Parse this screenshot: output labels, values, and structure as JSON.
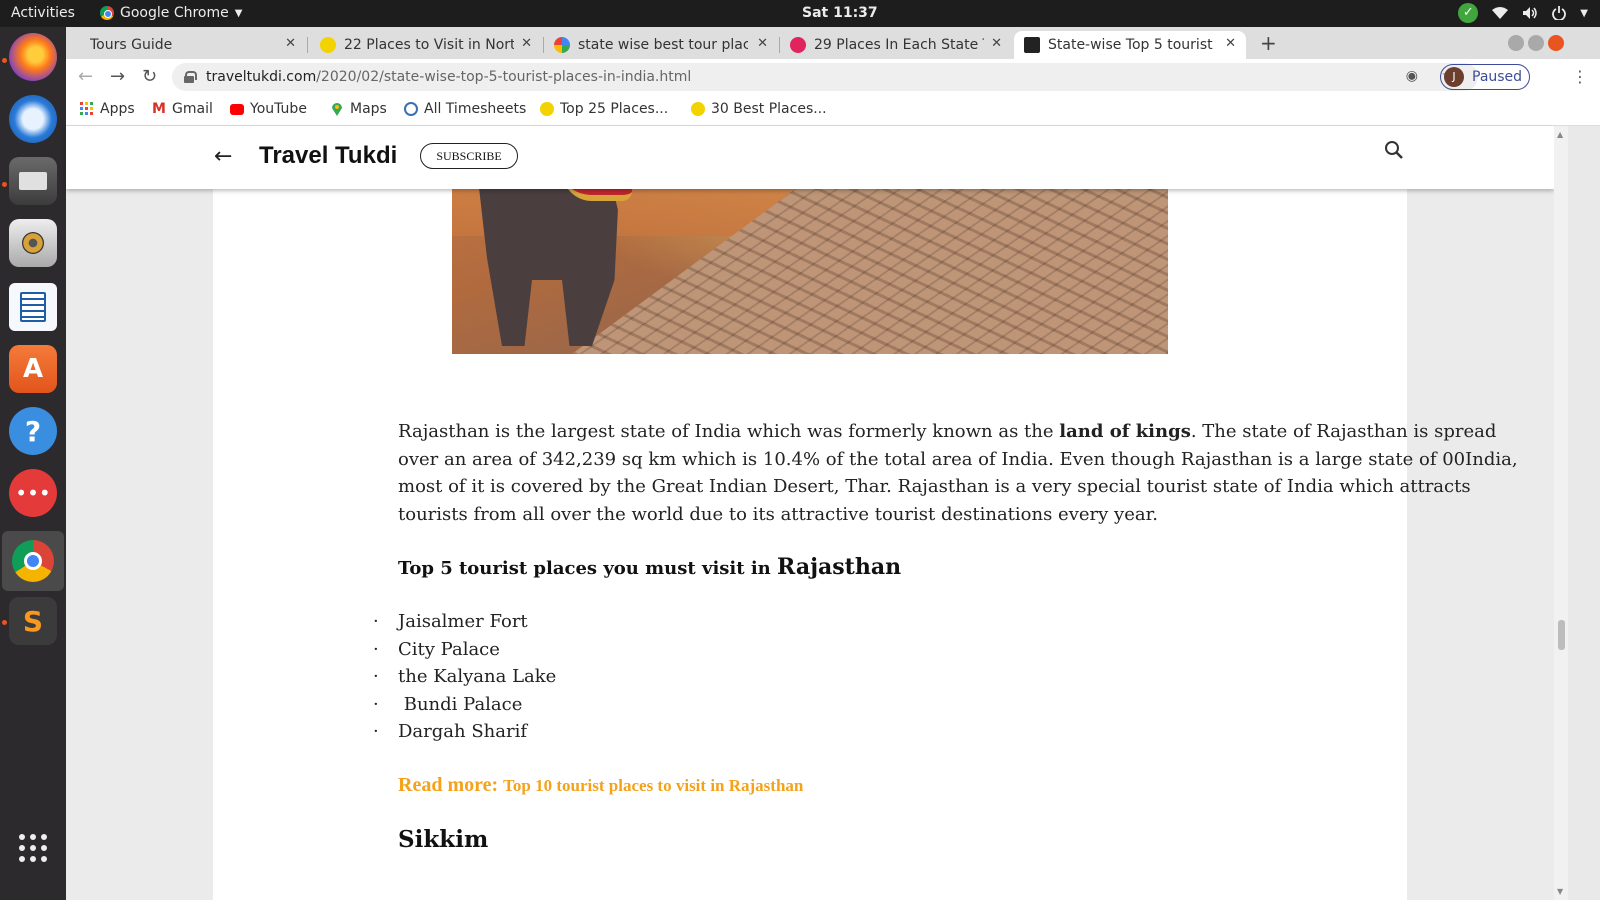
{
  "system": {
    "activities": "Activities",
    "app_name": "Google Chrome",
    "clock": "Sat 11:37"
  },
  "dock": {
    "items": [
      "firefox-icon",
      "thunderbird-icon",
      "files-icon",
      "rhythmbox-icon",
      "writer-icon",
      "software-center-icon",
      "help-icon",
      "chat-icon",
      "chrome-icon",
      "sublime-icon",
      "app-grid-icon"
    ]
  },
  "tabs": [
    {
      "title": "Tours Guide",
      "active": false
    },
    {
      "title": "22 Places to Visit in North",
      "active": false
    },
    {
      "title": "state wise best tour place",
      "active": false
    },
    {
      "title": "29 Places In Each State Th",
      "active": false
    },
    {
      "title": "State-wise Top 5 tourist p",
      "active": true
    }
  ],
  "toolbar": {
    "url_host": "traveltukdi.com",
    "url_path": "/2020/02/state-wise-top-5-tourist-places-in-india.html",
    "profile_initial": "J",
    "profile_status": "Paused"
  },
  "bookmarks": [
    {
      "label": "Apps",
      "icon": "apps-grid-icon"
    },
    {
      "label": "Gmail",
      "icon": "gmail-icon"
    },
    {
      "label": "YouTube",
      "icon": "youtube-icon"
    },
    {
      "label": "Maps",
      "icon": "maps-icon"
    },
    {
      "label": "All Timesheets",
      "icon": "timesheets-icon"
    },
    {
      "label": "Top 25 Places...",
      "icon": "site-icon"
    },
    {
      "label": "30 Best Places...",
      "icon": "site-icon"
    }
  ],
  "site": {
    "brand": "Travel Tukdi",
    "subscribe": "SUBSCRIBE"
  },
  "article": {
    "para_part1": "Rajasthan is the largest state of India which was formerly known as the ",
    "para_bold": "land of kings",
    "para_part2": ". The state of Rajasthan is spread over an area of 342,239 sq km which is 10.4% of the total area of India. Even though Rajasthan is a large state of 00India, most of it is covered by the Great Indian Desert, Thar. Rajasthan is a very special tourist state of India which attracts tourists from all over the world due to its attractive tourist destinations every year.",
    "heading_prefix": "Top 5 tourist places you must visit in ",
    "heading_state": "Rajasthan",
    "bullet": "·",
    "places": [
      "Jaisalmer Fort",
      "City Palace",
      "the Kalyana Lake",
      " Bundi Palace",
      "Dargah Sharif"
    ],
    "read_more_label": "Read more: ",
    "read_more_link": "Top 10 tourist places to visit in Rajasthan",
    "next_heading": "Sikkim"
  },
  "colors": {
    "accent_link": "#f5a21b",
    "profile_border": "#3c4c9a",
    "ubuntu_orange": "#e95420"
  }
}
